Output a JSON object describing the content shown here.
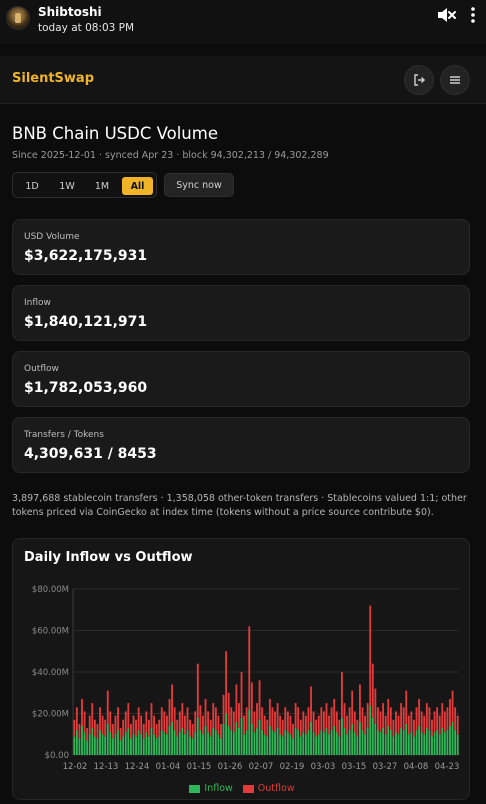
{
  "notification": {
    "sender": "Shibtoshi",
    "time": "today at 08:03 PM",
    "icons": {
      "mute": "volume-mute-icon",
      "more": "more-vertical-icon"
    }
  },
  "header": {
    "brand": "SilentSwap",
    "icons": {
      "logout": "logout-icon",
      "menu": "hamburger-menu-icon"
    }
  },
  "page": {
    "title": "BNB Chain USDC Volume",
    "subtitle": "Since 2025-12-01 · synced Apr 23 · block 94,302,213 / 94,302,289",
    "ranges": [
      "1D",
      "1W",
      "1M",
      "All"
    ],
    "active_range": "All",
    "sync_label": "Sync now"
  },
  "stats": [
    {
      "label": "USD Volume",
      "value": "$3,622,175,931"
    },
    {
      "label": "Inflow",
      "value": "$1,840,121,971"
    },
    {
      "label": "Outflow",
      "value": "$1,782,053,960"
    },
    {
      "label": "Transfers / Tokens",
      "value": "4,309,631 / 8453"
    }
  ],
  "footnote": "3,897,688 stablecoin transfers · 1,358,058 other-token transfers · Stablecoins valued 1:1; other tokens priced via CoinGecko at index time (tokens without a price source contribute $0).",
  "colors": {
    "accent": "#f0b429",
    "inflow": "#2fb85a",
    "outflow": "#e23b3b"
  },
  "chart_data": {
    "type": "bar",
    "stacked": true,
    "title": "Daily Inflow vs Outflow",
    "y_ticks": [
      "$0.00",
      "$20.00M",
      "$40.00M",
      "$60.00M",
      "$80.00M"
    ],
    "ylim": [
      0,
      80
    ],
    "y_unit": "millions USD",
    "x_tick_labels": [
      "12-02",
      "12-13",
      "12-24",
      "01-04",
      "01-15",
      "01-26",
      "02-07",
      "02-19",
      "03-03",
      "03-15",
      "03-27",
      "04-08",
      "04-23"
    ],
    "legend": [
      "Inflow",
      "Outflow"
    ],
    "legend_position": "bottom",
    "grid": true,
    "series": [
      {
        "name": "Inflow",
        "color": "#2fb85a",
        "values": [
          9,
          12,
          8,
          14,
          11,
          7,
          10,
          13,
          9,
          8,
          12,
          10,
          9,
          15,
          11,
          8,
          10,
          12,
          7,
          9,
          11,
          13,
          8,
          10,
          9,
          12,
          10,
          8,
          11,
          9,
          13,
          10,
          8,
          9,
          12,
          11,
          10,
          14,
          16,
          12,
          9,
          11,
          13,
          10,
          12,
          9,
          8,
          11,
          18,
          12,
          10,
          14,
          11,
          9,
          13,
          12,
          10,
          8,
          15,
          20,
          14,
          12,
          11,
          16,
          13,
          18,
          10,
          12,
          22,
          15,
          11,
          13,
          17,
          12,
          10,
          9,
          14,
          12,
          11,
          13,
          10,
          9,
          12,
          11,
          10,
          8,
          13,
          12,
          9,
          11,
          10,
          12,
          16,
          11,
          9,
          10,
          12,
          11,
          13,
          10,
          12,
          14,
          11,
          9,
          18,
          13,
          10,
          12,
          15,
          11,
          9,
          16,
          12,
          10,
          13,
          24,
          18,
          15,
          12,
          11,
          13,
          10,
          14,
          12,
          9,
          11,
          10,
          13,
          12,
          15,
          10,
          11,
          9,
          12,
          14,
          11,
          10,
          13,
          12,
          9,
          11,
          12,
          10,
          13,
          11,
          12,
          14,
          16,
          12,
          10
        ]
      },
      {
        "name": "Outflow",
        "color": "#e23b3b",
        "values": [
          8,
          11,
          7,
          13,
          10,
          6,
          9,
          12,
          8,
          7,
          11,
          9,
          8,
          16,
          10,
          7,
          9,
          11,
          6,
          8,
          10,
          12,
          7,
          9,
          8,
          11,
          9,
          7,
          10,
          8,
          12,
          9,
          7,
          8,
          11,
          10,
          9,
          13,
          18,
          11,
          8,
          10,
          12,
          9,
          11,
          8,
          7,
          10,
          26,
          12,
          9,
          13,
          10,
          8,
          12,
          11,
          9,
          7,
          14,
          30,
          16,
          11,
          10,
          18,
          12,
          22,
          9,
          11,
          40,
          20,
          10,
          12,
          19,
          11,
          9,
          8,
          13,
          11,
          10,
          12,
          9,
          8,
          11,
          10,
          9,
          7,
          12,
          11,
          8,
          10,
          9,
          11,
          17,
          10,
          8,
          9,
          11,
          10,
          12,
          9,
          11,
          13,
          10,
          8,
          22,
          12,
          9,
          11,
          16,
          10,
          8,
          18,
          11,
          9,
          12,
          48,
          26,
          17,
          11,
          10,
          12,
          9,
          13,
          11,
          8,
          10,
          9,
          12,
          11,
          16,
          9,
          10,
          8,
          11,
          13,
          10,
          9,
          12,
          11,
          8,
          10,
          11,
          9,
          12,
          10,
          11,
          13,
          15,
          11,
          9
        ]
      }
    ]
  }
}
